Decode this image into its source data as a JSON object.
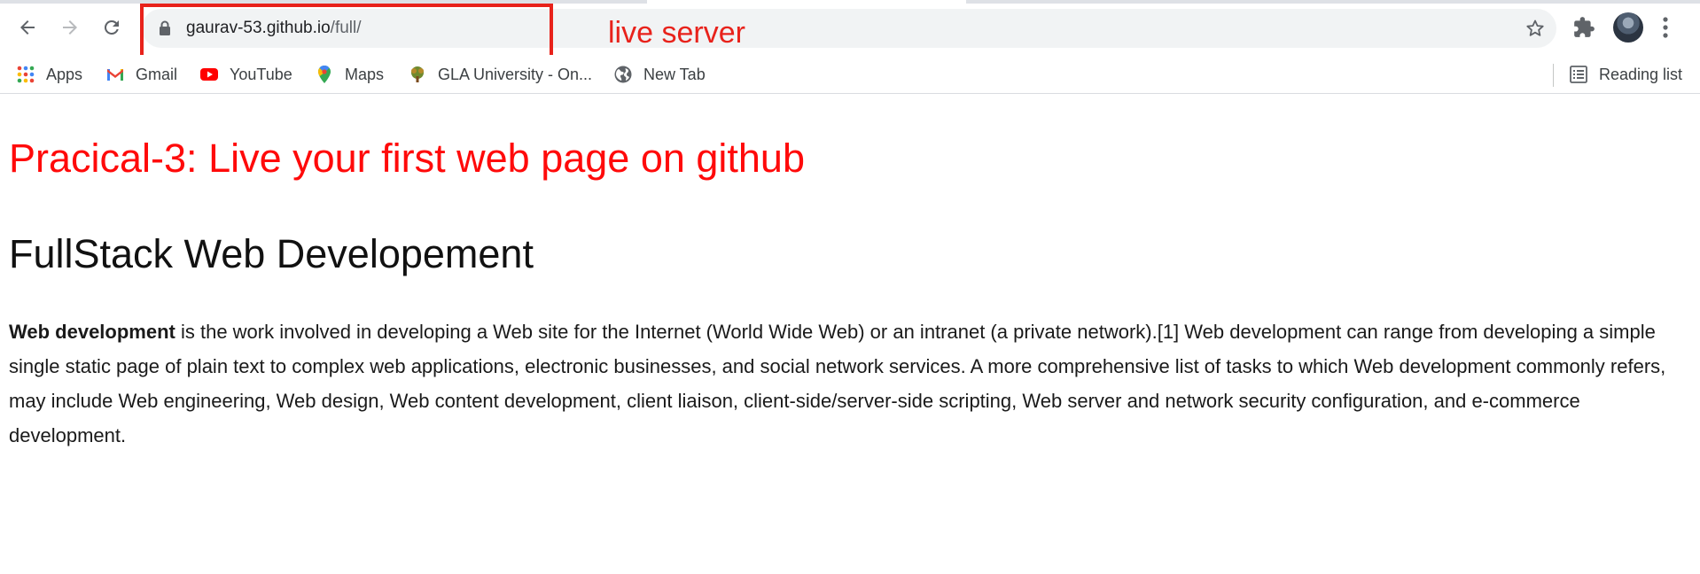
{
  "browser": {
    "url_host": "gaurav-53.github.io",
    "url_path": "/full/",
    "annotation_label": "live server",
    "annotation_color": "#e8221b"
  },
  "icons": {
    "back": "arrow-left-icon",
    "forward": "arrow-right-icon",
    "reload": "reload-icon",
    "lock": "lock-icon",
    "bookmark_star": "star-icon",
    "extensions": "puzzle-icon",
    "menu": "kebab-menu-icon",
    "reading_list": "reading-list-icon"
  },
  "bookmarks": {
    "items": [
      {
        "label": "Apps",
        "icon": "apps-grid-icon"
      },
      {
        "label": "Gmail",
        "icon": "gmail-icon"
      },
      {
        "label": "YouTube",
        "icon": "youtube-icon"
      },
      {
        "label": "Maps",
        "icon": "maps-pin-icon"
      },
      {
        "label": "GLA University - On...",
        "icon": "gla-logo-icon"
      },
      {
        "label": "New Tab",
        "icon": "globe-icon"
      }
    ],
    "reading_list": "Reading list"
  },
  "page": {
    "heading": "Pracical-3: Live your first web page on github",
    "heading_color": "#ff0a0a",
    "subheading": "FullStack Web Developement",
    "paragraph_bold": "Web development",
    "paragraph_rest": " is the work involved in developing a Web site for the Internet (World Wide Web) or an intranet (a private network).[1] Web development can range from developing a simple single static page of plain text to complex web applications, electronic businesses, and social network services. A more comprehensive list of tasks to which Web development commonly refers, may include Web engineering, Web design, Web content development, client liaison, client-side/server-side scripting, Web server and network security configuration, and e-commerce development."
  }
}
